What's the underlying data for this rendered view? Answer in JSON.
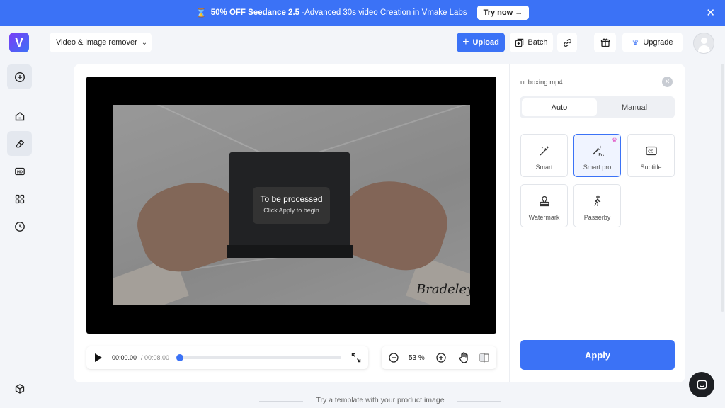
{
  "promo": {
    "icon": "hourglass-icon",
    "highlight": "50% OFF Seedance 2.5",
    "text": " -Advanced 30s video Creation in Vmake Labs",
    "cta": "Try now →"
  },
  "app": {
    "logo_letter": "V",
    "brand_color": "#3b72f6"
  },
  "toolbar": {
    "tool_select": "Video & image remover",
    "upload": "Upload",
    "batch": "Batch",
    "upgrade": "Upgrade"
  },
  "sidebar": {
    "items": [
      {
        "icon": "plus-circle-icon"
      },
      {
        "icon": "home-icon"
      },
      {
        "icon": "eraser-icon",
        "active": true
      },
      {
        "icon": "hd-icon"
      },
      {
        "icon": "grid-icon"
      },
      {
        "icon": "clock-icon"
      },
      {
        "icon": "box-icon"
      }
    ]
  },
  "preview": {
    "status_title": "To be processed",
    "status_hint": "Click Apply to begin",
    "signature": "Bradeley"
  },
  "player": {
    "current_time": "00:00.00",
    "total_time": "/ 00:08.00",
    "progress": 0.0,
    "zoom": "53 %"
  },
  "panel": {
    "file_name": "unboxing.mp4",
    "mode_auto": "Auto",
    "mode_manual": "Manual",
    "options": {
      "smart": "Smart",
      "smart_pro": "Smart pro",
      "subtitle": "Subtitle",
      "watermark": "Watermark",
      "passerby": "Passerby"
    },
    "selected_option": "Smart pro",
    "apply": "Apply"
  },
  "footer": {
    "template_hint": "Try a template with your product image"
  }
}
